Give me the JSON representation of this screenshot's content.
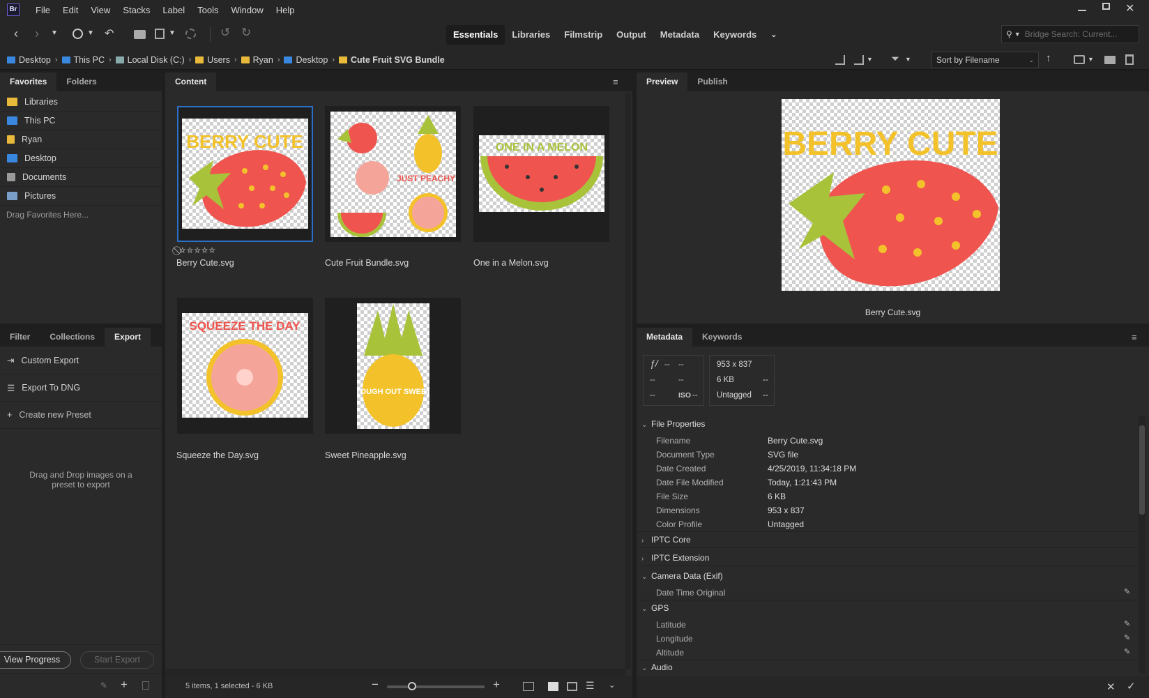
{
  "app": {
    "logo": "Br",
    "window_controls": [
      "minimize",
      "maximize",
      "close"
    ]
  },
  "menu": [
    "File",
    "Edit",
    "View",
    "Stacks",
    "Label",
    "Tools",
    "Window",
    "Help"
  ],
  "workspaces": {
    "items": [
      "Essentials",
      "Libraries",
      "Filmstrip",
      "Output",
      "Metadata",
      "Keywords"
    ],
    "active": "Essentials"
  },
  "search": {
    "placeholder": "Bridge Search: Current..."
  },
  "breadcrumb": [
    "Desktop",
    "This PC",
    "Local Disk (C:)",
    "Users",
    "Ryan",
    "Desktop",
    "Cute Fruit SVG Bundle"
  ],
  "sort": {
    "label": "Sort by Filename"
  },
  "left_top_tabs": [
    "Favorites",
    "Folders"
  ],
  "favorites": [
    {
      "label": "Libraries",
      "icon": "libraries-icon",
      "color": "#e8b93a"
    },
    {
      "label": "This PC",
      "icon": "computer-icon",
      "color": "#3a87e0"
    },
    {
      "label": "Ryan",
      "icon": "folder-icon",
      "color": "#e8b93a"
    },
    {
      "label": "Desktop",
      "icon": "desktop-icon",
      "color": "#3a87e0"
    },
    {
      "label": "Documents",
      "icon": "documents-icon",
      "color": "#9a9a9a"
    },
    {
      "label": "Pictures",
      "icon": "pictures-icon",
      "color": "#7a9fc9"
    }
  ],
  "favorites_hint": "Drag Favorites Here...",
  "left_bottom_tabs": [
    "Filter",
    "Collections",
    "Export"
  ],
  "export": {
    "items": [
      "Custom Export",
      "Export To DNG",
      "Create new Preset"
    ],
    "hint": "Drag and Drop images on a preset to export",
    "view_progress": "View Progress",
    "start_export": "Start Export"
  },
  "content": {
    "tab": "Content",
    "files": [
      "Berry Cute.svg",
      "Cute Fruit Bundle.svg",
      "One in a Melon.svg",
      "Squeeze the Day.svg",
      "Sweet Pineapple.svg"
    ],
    "status": "5 items, 1 selected - 6 KB"
  },
  "artwork_text": {
    "berry": "BERRY CUTE",
    "melon": "ONE IN A MELON",
    "squeeze": "SQUEEZE THE DAY",
    "pineapple": "TOUGH OUT SWEET",
    "bundle_peach": "JUST PEACHY"
  },
  "preview": {
    "tabs": [
      "Preview",
      "Publish"
    ],
    "caption": "Berry Cute.svg"
  },
  "metadata": {
    "tabs": [
      "Metadata",
      "Keywords"
    ],
    "camera_box": {
      "aperture": "--",
      "shutter": "--",
      "c1": "--",
      "c2": "--",
      "c3": "--",
      "iso_label": "ISO",
      "iso": "--"
    },
    "file_box": {
      "dimensions": "953 x 837",
      "size": "6 KB",
      "size_extra": "--",
      "profile": "Untagged",
      "profile_extra": "--"
    },
    "file_properties": {
      "title": "File Properties",
      "rows": [
        {
          "label": "Filename",
          "value": "Berry Cute.svg"
        },
        {
          "label": "Document Type",
          "value": "SVG file"
        },
        {
          "label": "Date Created",
          "value": "4/25/2019, 11:34:18 PM"
        },
        {
          "label": "Date File Modified",
          "value": "Today, 1:21:43 PM"
        },
        {
          "label": "File Size",
          "value": "6 KB"
        },
        {
          "label": "Dimensions",
          "value": "953 x 837"
        },
        {
          "label": "Color Profile",
          "value": "Untagged"
        }
      ]
    },
    "sections": [
      "IPTC Core",
      "IPTC Extension",
      "Camera Data (Exif)",
      "GPS",
      "Audio"
    ],
    "exif_fields": [
      "Date Time Original"
    ],
    "gps_fields": [
      "Latitude",
      "Longitude",
      "Altitude"
    ]
  },
  "colors": {
    "accent": "#2c6fc9",
    "strawberry": "#f0544f",
    "leaf": "#a8c23a",
    "berry_text": "#f3c22a"
  }
}
